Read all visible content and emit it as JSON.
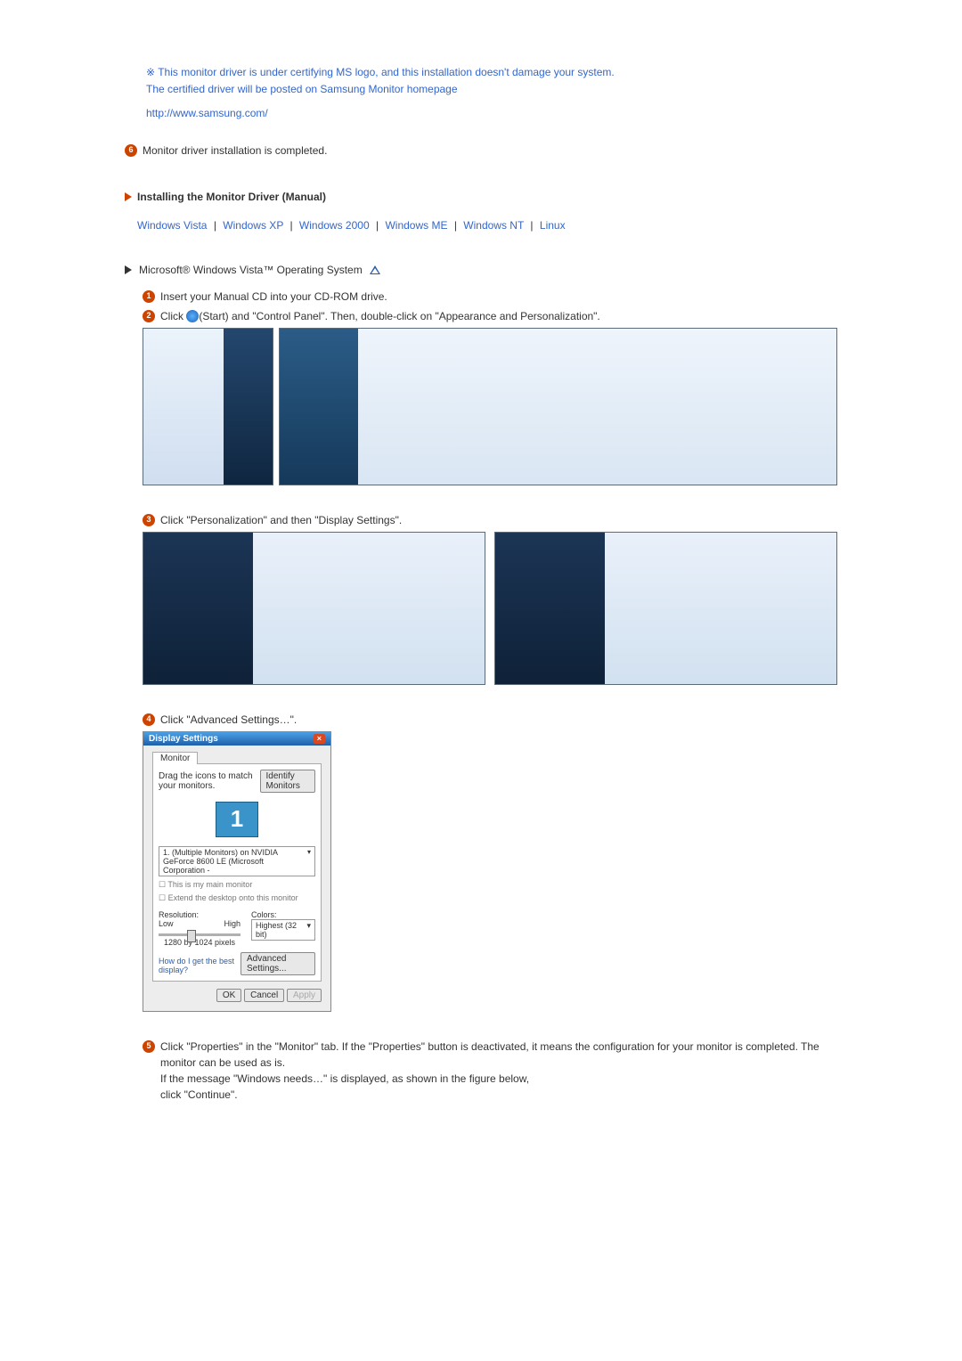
{
  "notice": {
    "marker": "※",
    "line1": "This monitor driver is under certifying MS logo, and this installation doesn't damage your system.",
    "line2": "The certified driver will be posted on Samsung Monitor homepage",
    "url": "http://www.samsung.com/"
  },
  "step6": "Monitor driver installation is completed.",
  "section_title": "Installing the Monitor Driver (Manual)",
  "os_links": {
    "vista": "Windows Vista",
    "xp": "Windows XP",
    "w2000": "Windows 2000",
    "me": "Windows ME",
    "nt": "Windows NT",
    "linux": "Linux"
  },
  "subhead_text": "Microsoft® Windows Vista™ Operating System",
  "steps": {
    "s1": "Insert your Manual CD into your CD-ROM drive.",
    "s2a": "Click ",
    "s2b": "(Start) and \"Control Panel\". Then, double-click on \"Appearance and Personalization\".",
    "s3": "Click \"Personalization\" and then \"Display Settings\".",
    "s4": "Click \"Advanced Settings…\".",
    "s5a": "Click \"Properties\" in the \"Monitor\" tab. If the \"Properties\" button is deactivated, it means the configuration for your monitor is completed. The monitor can be used as is.",
    "s5b": "If the message \"Windows needs…\" is displayed, as shown in the figure below,",
    "s5c": "click \"Continue\"."
  },
  "dialog": {
    "title": "Display Settings",
    "tab": "Monitor",
    "drag_text": "Drag the icons to match your monitors.",
    "identify_btn": "Identify Monitors",
    "monitor_num": "1",
    "select_text": "1. (Multiple Monitors) on NVIDIA GeForce 8600 LE (Microsoft Corporation - ",
    "chk1": "This is my main monitor",
    "chk2": "Extend the desktop onto this monitor",
    "resolution_label": "Resolution:",
    "low": "Low",
    "high": "High",
    "res_value": "1280 by 1024 pixels",
    "colors_label": "Colors:",
    "colors_value": "Highest (32 bit)",
    "best_link": "How do I get the best display?",
    "adv_btn": "Advanced Settings...",
    "ok": "OK",
    "cancel": "Cancel",
    "apply": "Apply"
  }
}
